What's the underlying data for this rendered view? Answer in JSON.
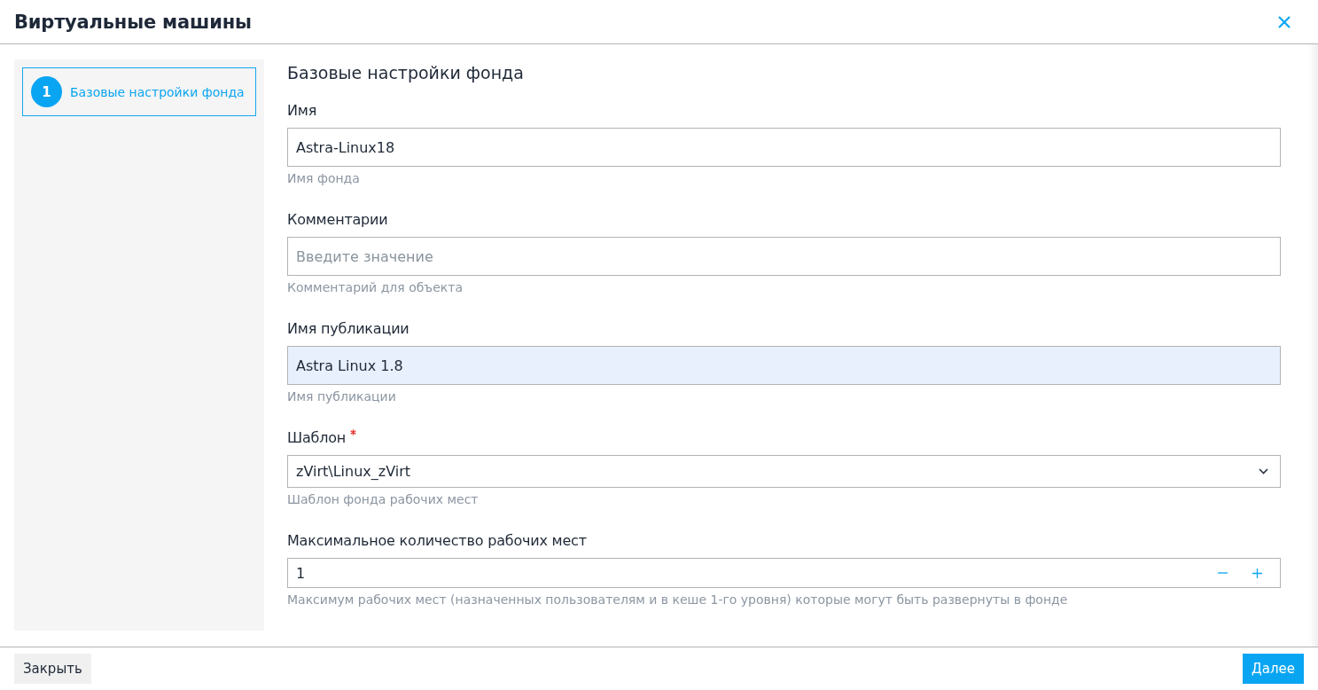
{
  "dialog": {
    "title": "Виртуальные машины"
  },
  "steps": [
    {
      "number": "1",
      "label": "Базовые настройки фонда",
      "selected": true
    }
  ],
  "section_title": "Базовые настройки фонда",
  "fields": [
    {
      "kind": "text",
      "label": "Имя",
      "required": false,
      "value": "Astra-Linux18",
      "hint": "Имя фонда",
      "autofilled": false
    },
    {
      "kind": "text",
      "label": "Комментарии",
      "required": false,
      "placeholder": "Введите значение",
      "hint": "Комментарий для объекта",
      "autofilled": false
    },
    {
      "kind": "text",
      "label": "Имя публикации",
      "required": false,
      "value": "Astra Linux 1.8",
      "hint": "Имя публикации",
      "autofilled": true
    },
    {
      "kind": "select",
      "label": "Шаблон",
      "required": true,
      "value": "zVirt\\Linux_zVirt",
      "hint": "Шаблон фонда рабочих мест",
      "autofilled": false
    },
    {
      "kind": "number",
      "label": "Максимальное количество рабочих мест",
      "required": false,
      "value": "1",
      "hint": "Максимум рабочих мест (назначенных пользователям и в кеше 1-го уровня) которые могут быть развернуты в фонде",
      "autofilled": false
    }
  ],
  "buttons": [
    {
      "label": "Закрыть",
      "kind": "secondary"
    },
    {
      "label": "Далее",
      "kind": "primary"
    }
  ]
}
